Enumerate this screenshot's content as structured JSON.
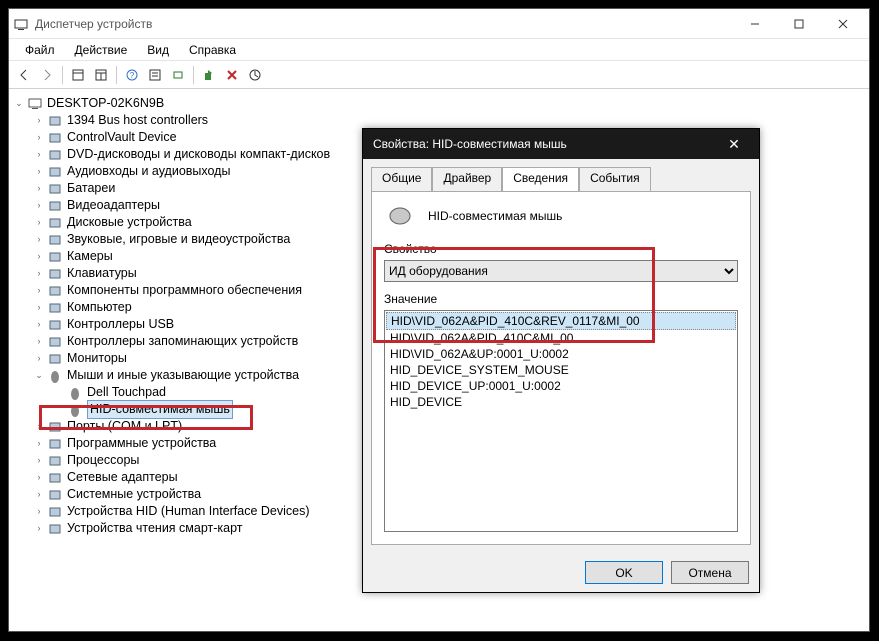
{
  "window": {
    "title": "Диспетчер устройств"
  },
  "menu": {
    "file": "Файл",
    "action": "Действие",
    "view": "Вид",
    "help": "Справка"
  },
  "tree": {
    "root": "DESKTOP-02K6N9B",
    "items": [
      "1394 Bus host controllers",
      "ControlVault Device",
      "DVD-дисководы и дисководы компакт-дисков",
      "Аудиовходы и аудиовыходы",
      "Батареи",
      "Видеоадаптеры",
      "Дисковые устройства",
      "Звуковые, игровые и видеоустройства",
      "Камеры",
      "Клавиатуры",
      "Компоненты программного обеспечения",
      "Компьютер",
      "Контроллеры USB",
      "Контроллеры запоминающих устройств",
      "Мониторы"
    ],
    "mice_category": "Мыши и иные указывающие устройства",
    "mice_children": {
      "touchpad": "Dell Touchpad",
      "hid_mouse": "HID-совместимая мышь"
    },
    "items_after": [
      "Порты (COM и LPT)",
      "Программные устройства",
      "Процессоры",
      "Сетевые адаптеры",
      "Системные устройства",
      "Устройства HID (Human Interface Devices)",
      "Устройства чтения смарт-карт"
    ]
  },
  "dialog": {
    "title": "Свойства: HID-совместимая мышь",
    "tabs": {
      "general": "Общие",
      "driver": "Драйвер",
      "details": "Сведения",
      "events": "События"
    },
    "device_name": "HID-совместимая мышь",
    "property_label": "Свойство",
    "property_value": "ИД оборудования",
    "value_label": "Значение",
    "values": [
      "HID\\VID_062A&PID_410C&REV_0117&MI_00",
      "HID\\VID_062A&PID_410C&MI_00",
      "HID\\VID_062A&UP:0001_U:0002",
      "HID_DEVICE_SYSTEM_MOUSE",
      "HID_DEVICE_UP:0001_U:0002",
      "HID_DEVICE"
    ],
    "ok": "OK",
    "cancel": "Отмена"
  }
}
